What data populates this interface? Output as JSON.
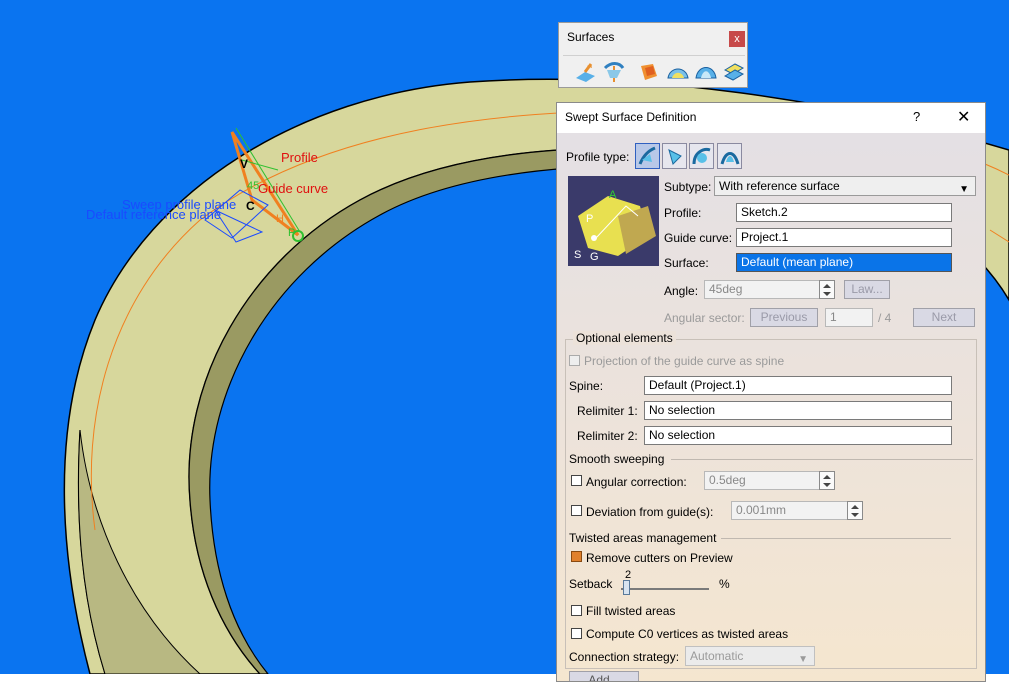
{
  "viewport": {
    "annotations": {
      "profile": "Profile",
      "guide_curve": "Guide curve",
      "sweep_profile_plane": "Sweep profile plane",
      "default_reference_plane": "Default reference plane",
      "angle": "45",
      "v": "V",
      "c": "C",
      "h": "H",
      "p": "P"
    }
  },
  "toolbar": {
    "title": "Surfaces",
    "close": "x",
    "icons": [
      "extrude-icon",
      "revolve-icon",
      "sphere-icon",
      "cylinder-icon",
      "sweep-icon",
      "fill-icon"
    ]
  },
  "dialog": {
    "title": "Swept Surface Definition",
    "help": "?",
    "close": "✕",
    "profile_type_label": "Profile type:",
    "profile_types": [
      "explicit-profile-icon",
      "line-profile-icon",
      "circle-profile-icon",
      "conic-profile-icon"
    ],
    "preview_labels": {
      "a": "A",
      "p": "P",
      "s": "S",
      "g": "G"
    },
    "subtype_label": "Subtype:",
    "subtype_value": "With reference surface",
    "profile_label": "Profile:",
    "profile_value": "Sketch.2",
    "guide_label": "Guide curve:",
    "guide_value": "Project.1",
    "surface_label": "Surface:",
    "surface_value": "Default (mean plane)",
    "angle_label": "Angle:",
    "angle_value": "45deg",
    "law_button": "Law...",
    "angular_sector_label": "Angular sector:",
    "previous_button": "Previous",
    "sector_value": "1",
    "sector_total": "/ 4",
    "next_button": "Next",
    "optional_title": "Optional elements",
    "projection_label": "Projection of the guide curve as spine",
    "spine_label": "Spine:",
    "spine_value": "Default (Project.1)",
    "relimiter1_label": "Relimiter 1:",
    "relimiter1_value": "No selection",
    "relimiter2_label": "Relimiter 2:",
    "relimiter2_value": "No selection",
    "smooth_title": "Smooth sweeping",
    "angular_correction_label": "Angular correction:",
    "angular_correction_value": "0.5deg",
    "deviation_label": "Deviation from guide(s):",
    "deviation_value": "0.001mm",
    "twisted_title": "Twisted areas management",
    "remove_cutters_label": "Remove cutters on Preview",
    "setback_label": "Setback",
    "setback_value": "2",
    "setback_level": 2,
    "setback_unit": "%",
    "fill_twisted_label": "Fill twisted areas",
    "compute_c0_label": "Compute C0 vertices as twisted areas",
    "connection_label": "Connection strategy:",
    "connection_value": "Automatic",
    "add_button": "Add..."
  }
}
